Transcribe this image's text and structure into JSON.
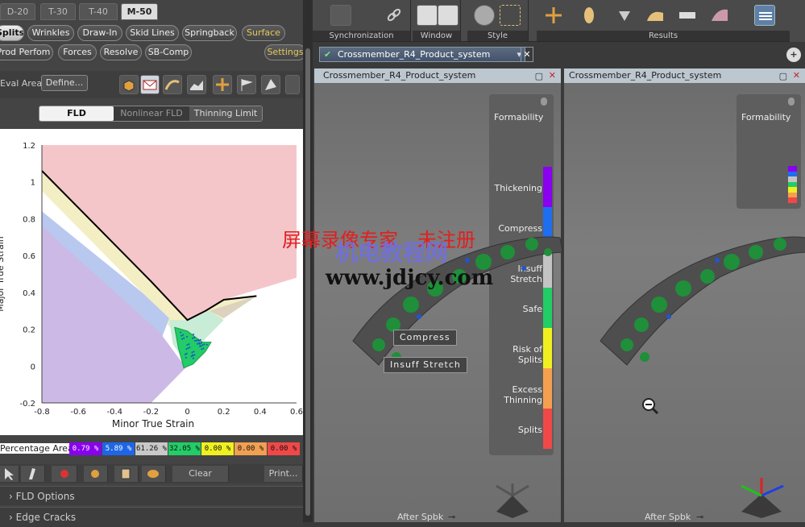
{
  "variant_tabs": [
    "D-20",
    "T-30",
    "T-40",
    "M-50"
  ],
  "analysis_tabs_row1": [
    "Splits",
    "Wrinkles",
    "Draw-In",
    "Skid Lines",
    "Springback",
    "Surface"
  ],
  "analysis_tabs_row2": [
    "Prod Perfom",
    "Forces",
    "Resolve",
    "SB-Comp"
  ],
  "settings_label": "Settings",
  "eval_area_label": "Eval Area",
  "define_label": "Define...",
  "fld_tabs": [
    "FLD",
    "Nonlinear FLD",
    "Thinning Limit"
  ],
  "chart_data": {
    "type": "area",
    "xlabel": "Minor True Strain",
    "ylabel": "Major True Strain",
    "xlim": [
      -0.8,
      0.6
    ],
    "ylim": [
      -0.2,
      1.2
    ],
    "x_ticks": [
      "-0.8",
      "-0.6",
      "-0.4",
      "-0.2",
      "0",
      "0.2",
      "0.4",
      "0.6"
    ],
    "y_ticks": [
      "1.2",
      "1",
      "0.8",
      "0.6",
      "0.4",
      "0.2",
      "0",
      "-0.2"
    ],
    "flc_curve": {
      "x": [
        -0.8,
        -0.6,
        -0.4,
        -0.2,
        0.0,
        0.1,
        0.2,
        0.38
      ],
      "y": [
        1.06,
        0.86,
        0.66,
        0.46,
        0.25,
        0.3,
        0.36,
        0.38
      ]
    },
    "regions": [
      {
        "name": "splits",
        "color": "#f4c6ca"
      },
      {
        "name": "risk",
        "color": "#f3eec4"
      },
      {
        "name": "insuff_stretch",
        "color": "#b9c8ee"
      },
      {
        "name": "compress",
        "color": "#cdb9e6"
      },
      {
        "name": "safe",
        "color": "#c8ecd6"
      },
      {
        "name": "excess_thinning",
        "color": "#dcd2be"
      }
    ],
    "points_region": {
      "x": [
        -0.07,
        0.0,
        0.08,
        0.13,
        0.1,
        0.03,
        -0.02,
        -0.05
      ],
      "y": [
        0.21,
        0.19,
        0.13,
        0.13,
        0.08,
        0.01,
        -0.01,
        0.1
      ]
    }
  },
  "percentage_label": "Percentage Area",
  "percentages": [
    {
      "value": "0.79 %",
      "color": "#8800ee"
    },
    {
      "value": "5.89 %",
      "color": "#1e66e6"
    },
    {
      "value": "61.26 %",
      "color": "#c8c8c8"
    },
    {
      "value": "32.05 %",
      "color": "#22cc66"
    },
    {
      "value": "0.00 %",
      "color": "#f0f020"
    },
    {
      "value": "0.00 %",
      "color": "#f0a050"
    },
    {
      "value": "0.00 %",
      "color": "#f04848"
    }
  ],
  "clear_label": "Clear",
  "print_label": "Print...",
  "sections": [
    "FLD Options",
    "Edge Cracks"
  ],
  "toolbar_groups": [
    "Synchronization",
    "Window",
    "Style",
    "Results"
  ],
  "doc_tab": "Crossmember_R4_Product_system",
  "viewports": [
    {
      "title": "Crossmember_R4_Product_system",
      "legend_title": "Formability",
      "after": "After Spbk"
    },
    {
      "title": "Crossmember_R4_Product_system",
      "legend_title": "Formability",
      "after": "After Spbk"
    }
  ],
  "legend": [
    {
      "label": "Thickening",
      "color": "#8a00f0"
    },
    {
      "label": "Compress",
      "color": "#1e6ef0"
    },
    {
      "label": "Insuff\nStretch",
      "color": "#c4c4c4"
    },
    {
      "label": "Safe",
      "color": "#22cc66"
    },
    {
      "label": "Risk of\nSplits",
      "color": "#f0f020"
    },
    {
      "label": "Excess\nThinning",
      "color": "#f4a050"
    },
    {
      "label": "Splits",
      "color": "#f04848"
    }
  ],
  "callouts": [
    "Compress",
    "Insuff Stretch"
  ],
  "watermark": {
    "line1": "屏幕录像专家　未注册",
    "line2": "机电教程网",
    "line3": "www.jdjcy.com"
  }
}
